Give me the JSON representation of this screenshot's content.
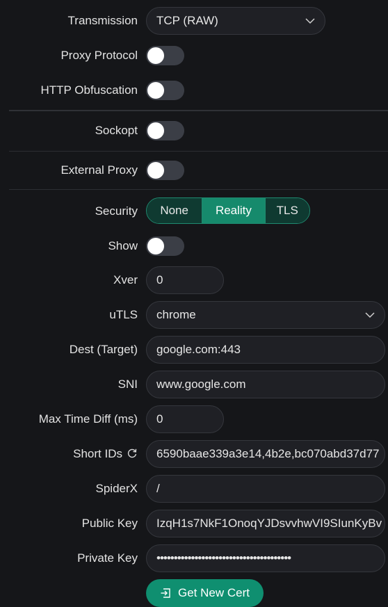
{
  "transmission": {
    "label": "Transmission",
    "value": "TCP (RAW)"
  },
  "proxy_protocol": {
    "label": "Proxy Protocol"
  },
  "http_obfuscation": {
    "label": "HTTP Obfuscation"
  },
  "sockopt": {
    "label": "Sockopt"
  },
  "external_proxy": {
    "label": "External Proxy"
  },
  "security": {
    "label": "Security",
    "options": [
      "None",
      "Reality",
      "TLS"
    ],
    "selected": "Reality"
  },
  "show": {
    "label": "Show"
  },
  "xver": {
    "label": "Xver",
    "value": "0"
  },
  "utls": {
    "label": "uTLS",
    "value": "chrome"
  },
  "dest": {
    "label": "Dest (Target)",
    "value": "google.com:443"
  },
  "sni": {
    "label": "SNI",
    "value": "www.google.com"
  },
  "max_time_diff": {
    "label": "Max Time Diff (ms)",
    "value": "0"
  },
  "short_ids": {
    "label": "Short IDs",
    "value": "6590baae339a3e14,4b2e,bc070abd37d77"
  },
  "spiderx": {
    "label": "SpiderX",
    "value": "/"
  },
  "public_key": {
    "label": "Public Key",
    "value": "IzqH1s7NkF1OnoqYJDsvvhwVI9SIunKyBv"
  },
  "private_key": {
    "label": "Private Key",
    "value": "•••••••••••••••••••••••••••••••••••••••"
  },
  "get_new_cert": {
    "label": "Get New Cert"
  },
  "colors": {
    "accent": "#0f8f70",
    "background": "#151619",
    "field": "#1f2025"
  }
}
